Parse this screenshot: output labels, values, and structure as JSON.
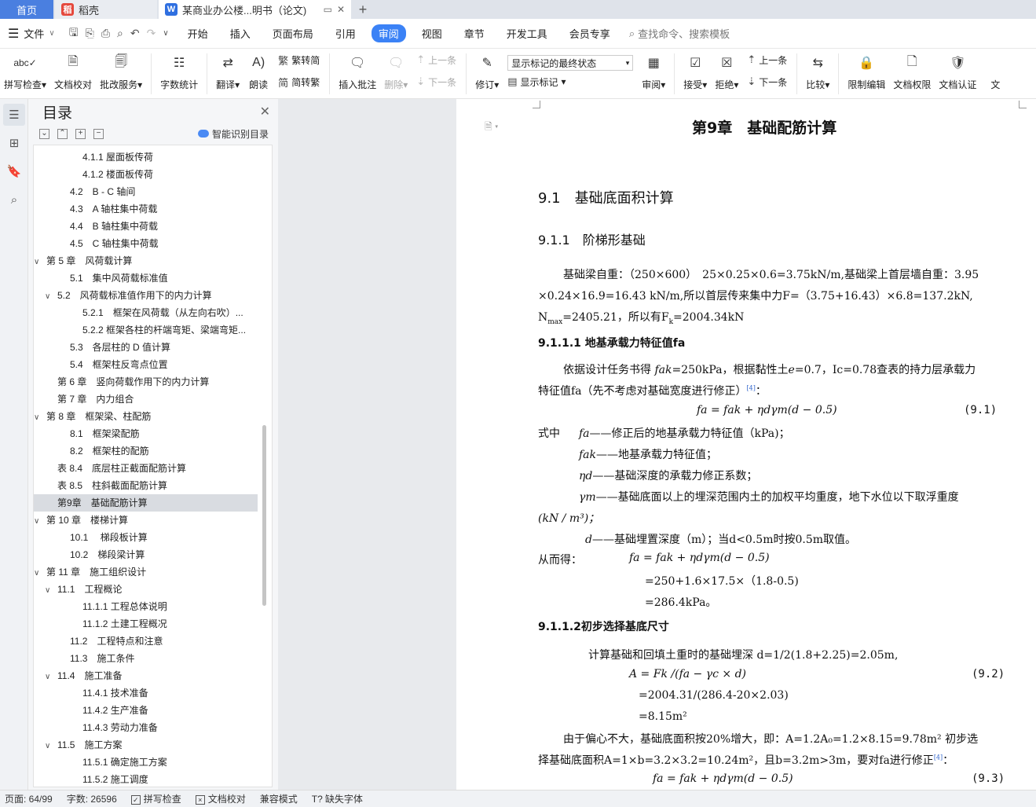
{
  "tabs": {
    "home": "首页",
    "daoke": "稻壳",
    "doc": "某商业办公楼...明书（论文)",
    "add": "+"
  },
  "menu": {
    "file": "文件",
    "tabs": [
      "开始",
      "插入",
      "页面布局",
      "引用",
      "审阅",
      "视图",
      "章节",
      "开发工具",
      "会员专享"
    ],
    "active": "审阅",
    "search": "查找命令、搜索模板"
  },
  "ribbon": {
    "spell": "拼写检查",
    "proofread": "文档校对",
    "batch": "批改服务",
    "wordcount": "字数统计",
    "translate": "翻译",
    "read": "朗读",
    "trad": "繁转简",
    "simp": "简转繁",
    "insert_comment": "插入批注",
    "delete": "删除",
    "prev": "上一条",
    "next": "下一条",
    "revise": "修订",
    "mark_select": "显示标记的最终状态",
    "show_mark": "显示标记",
    "review": "审阅",
    "accept": "接受",
    "reject": "拒绝",
    "prev2": "上一条",
    "next2": "下一条",
    "compare": "比较",
    "restrict": "限制编辑",
    "perm": "文档权限",
    "cert": "文档认证",
    "more": "文"
  },
  "toc": {
    "title": "目录",
    "ai": "智能识别目录",
    "items": [
      {
        "text": "4.1.1 屋面板传荷",
        "arrow": ""
      },
      {
        "text": "4.1.2 楼面板传荷",
        "arrow": ""
      },
      {
        "text": "4.2　B - C 轴间",
        "arrow": ""
      },
      {
        "text": "4.3　A 轴柱集中荷载",
        "arrow": ""
      },
      {
        "text": "4.4　B 轴柱集中荷载",
        "arrow": ""
      },
      {
        "text": "4.5　C 轴柱集中荷载",
        "arrow": ""
      },
      {
        "text": "第 5 章　风荷载计算",
        "arrow": "∨"
      },
      {
        "text": "5.1　集中风荷载标准值",
        "arrow": ""
      },
      {
        "text": "5.2　风荷载标准值作用下的内力计算",
        "arrow": "∨"
      },
      {
        "text": "5.2.1　框架在风荷载（从左向右吹）...",
        "arrow": ""
      },
      {
        "text": "5.2.2 框架各柱的杆端弯矩、梁端弯矩...",
        "arrow": ""
      },
      {
        "text": "5.3　各层柱的 D 值计算",
        "arrow": ""
      },
      {
        "text": "5.4　框架柱反弯点位置",
        "arrow": ""
      },
      {
        "text": "第 6 章　竖向荷载作用下的内力计算",
        "arrow": ""
      },
      {
        "text": "第 7 章　内力组合",
        "arrow": ""
      },
      {
        "text": "第 8 章　框架梁、柱配筋",
        "arrow": "∨"
      },
      {
        "text": "8.1　框架梁配筋",
        "arrow": ""
      },
      {
        "text": "8.2　框架柱的配筋",
        "arrow": ""
      },
      {
        "text": "表 8.4　底层柱正截面配筋计算",
        "arrow": ""
      },
      {
        "text": "表 8.5　柱斜截面配筋计算",
        "arrow": ""
      },
      {
        "text": "第9章　基础配筋计算",
        "arrow": ""
      },
      {
        "text": "第 10 章　楼梯计算",
        "arrow": "∨"
      },
      {
        "text": "10.1　 梯段板计算",
        "arrow": ""
      },
      {
        "text": "10.2　梯段梁计算",
        "arrow": ""
      },
      {
        "text": "第 11 章　施工组织设计",
        "arrow": "∨"
      },
      {
        "text": "11.1　工程概论",
        "arrow": "∨"
      },
      {
        "text": "11.1.1 工程总体说明",
        "arrow": ""
      },
      {
        "text": "11.1.2 土建工程概况",
        "arrow": ""
      },
      {
        "text": "11.2　工程特点和注意",
        "arrow": ""
      },
      {
        "text": "11.3　施工条件",
        "arrow": ""
      },
      {
        "text": "11.4　施工准备",
        "arrow": "∨"
      },
      {
        "text": "11.4.1 技术准备",
        "arrow": ""
      },
      {
        "text": "11.4.2 生产准备",
        "arrow": ""
      },
      {
        "text": "11.4.3 劳动力准备",
        "arrow": ""
      },
      {
        "text": "11.5　施工方案",
        "arrow": "∨"
      },
      {
        "text": "11.5.1 确定施工方案",
        "arrow": ""
      },
      {
        "text": "11.5.2 施工调度",
        "arrow": ""
      }
    ]
  },
  "doc": {
    "chapter": "第9章　基础配筋计算",
    "s1": "9.1　基础底面积计算",
    "s2": "9.1.1　阶梯形基础",
    "p1a": "基础梁自重：（250×600）　25×0.25×0.6=3.75kN/m,基础梁上首层墙自重：3.95",
    "p1b": "×0.24×16.9=16.43 kN/m,所以首层传来集中力F=（3.75+16.43）×6.8=137.2kN,",
    "p1c": "N",
    "p1c_sub": "max",
    "p1d": "=2405.21，所以有F",
    "p1d_sub": "k",
    "p1e": "=2004.34kN",
    "s3": "9.1.1.1 地基承载力特征值fa",
    "p2a1": "依据设计任务书得 ",
    "p2a2": "=250kPa，根据黏性土",
    "p2a3": "=0.7，Ic=0.78查表的持力层承载力",
    "p2b": "特征值fa（先不考虑对基础宽度进行修正）",
    "ref4": "[4]",
    "colon": "：",
    "eq1": "fa = fak + ηdγm(d − 0.5)",
    "eq1no": "(9.1)",
    "w_lead": "式中",
    "w1": "——修正后的地基承载力特征值（kPa)；",
    "w2": "——地基承载力特征值；",
    "w3": "——基础深度的承载力修正系数；",
    "w4a": "——基础底面以上的埋深范围内土的加权平均重度，地下水位以下取浮重度",
    "w4b": "(kN / m³)；",
    "w5": "——基础埋置深度（m）；当d<0.5m时按0.5m取值。",
    "thus": "从而得：",
    "eq1b": "fa = fak + ηdγm(d − 0.5)",
    "calc1": "=250+1.6×17.5×（1.8-0.5)",
    "calc2": "=286.4kPa。",
    "s4": "9.1.1.2初步选择基底尺寸",
    "p3": "计算基础和回填土重时的基础埋深 d=1/2(1.8+2.25)=2.05m,",
    "eq2": "A = Fk /(fa − γc × d)",
    "eq2no": "(9.2)",
    "calc3": "=2004.31/(286.4-20×2.03)",
    "calc4": "=8.15m²",
    "p4a": "由于偏心不大，基础底面积按20%增大，即：A=1.2A₀=1.2×8.15=9.78m²  初步选",
    "p4b": "择基础底面积A=1×b=3.2×3.2=10.24m²，且b=3.2m>3m，要对fa进行修正",
    "eq3": "fa = fak + ηdγm(d − 0.5)",
    "eq3no": "(9.3)",
    "sym_fa": "fa",
    "sym_fak": "fak",
    "sym_eta": "ηd",
    "sym_gamma": "γm",
    "sym_d": "d",
    "sym_e": "e"
  },
  "status": {
    "page": "页面: 64/99",
    "words": "字数: 26596",
    "spell": "拼写检查",
    "proof": "文档校对",
    "compat": "兼容模式",
    "font": "缺失字体"
  }
}
